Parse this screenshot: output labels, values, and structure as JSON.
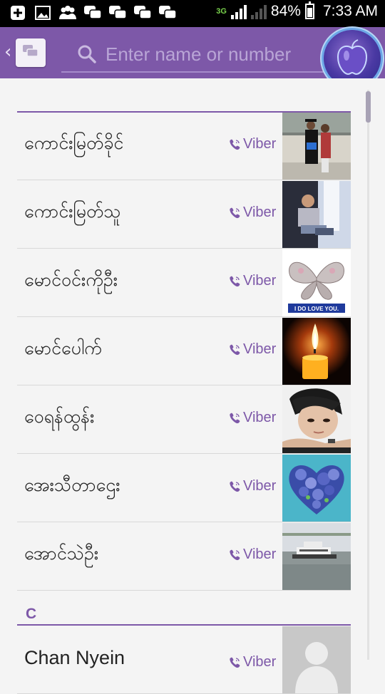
{
  "status_bar": {
    "network": "3G",
    "sim1": "1",
    "sim2": "2",
    "battery": "84%",
    "battery_level": 0.84,
    "time": "7:33 AM",
    "left_icons": [
      "plus-square-icon",
      "image-icon",
      "group-icon",
      "chat-icon",
      "chat-icon",
      "chat-icon",
      "chat-icon"
    ]
  },
  "toolbar": {
    "back_icon": "back-chevron-icon",
    "app_icon": "chat-bubbles-icon",
    "search_icon": "search-icon",
    "search_placeholder": "Enter name or number",
    "search_value": ""
  },
  "colors": {
    "accent": "#7d58a8",
    "toolbar": "#7d58a8",
    "background": "#f4f4f4"
  },
  "sections": [
    {
      "letter": "",
      "contacts": [
        {
          "name": "ကောင်းမြတ်ခိုင်",
          "viber": "Viber",
          "photo": "graduation-photo"
        },
        {
          "name": "ကောင်းမြတ်သူ",
          "viber": "Viber",
          "photo": "person-photo"
        },
        {
          "name": "မောင်ဝင်းကိုဦး",
          "viber": "Viber",
          "photo": "butterfly-photo",
          "photo_caption": "I DO LOVE YOU."
        },
        {
          "name": "မောင်ပေါက်",
          "viber": "Viber",
          "photo": "candle-photo"
        },
        {
          "name": "ဝေရန်ထွန်း",
          "viber": "Viber",
          "photo": "face-photo"
        },
        {
          "name": "အေးသီတာဌေး",
          "viber": "Viber",
          "photo": "flower-heart-photo"
        },
        {
          "name": "အောင်သဲဦး",
          "viber": "Viber",
          "photo": "boat-photo"
        }
      ]
    },
    {
      "letter": "C",
      "contacts": [
        {
          "name": "Chan Nyein",
          "viber": "Viber",
          "photo": "default-avatar"
        }
      ]
    }
  ]
}
